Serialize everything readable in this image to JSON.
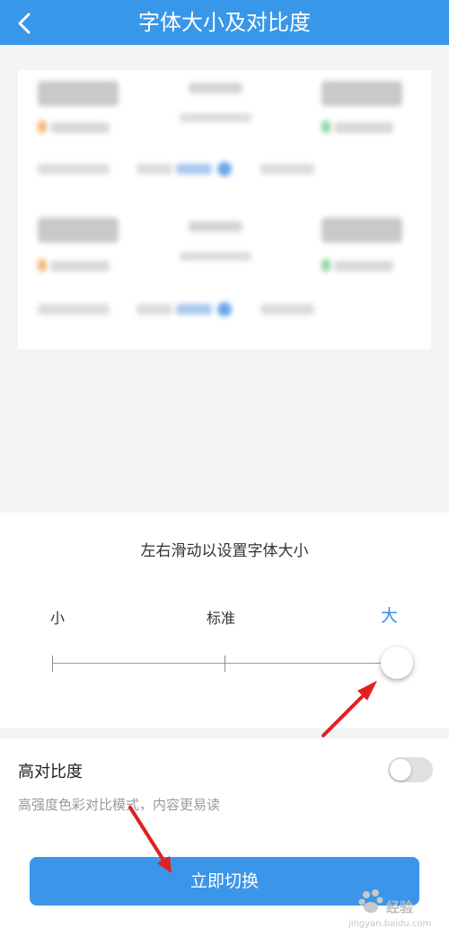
{
  "header": {
    "title": "字体大小及对比度",
    "back_icon": "chevron-left-icon"
  },
  "font_size": {
    "hint": "左右滑动以设置字体大小",
    "labels": {
      "small": "小",
      "standard": "标准",
      "large": "大"
    },
    "selected": "大",
    "level": 1.0
  },
  "contrast": {
    "title": "高对比度",
    "description": "高强度色彩对比模式，内容更易读",
    "enabled": false
  },
  "actions": {
    "switch_label": "立即切换"
  },
  "watermark": {
    "text": "经验",
    "sub": "jingyan.baidu.com"
  },
  "colors": {
    "accent": "#3897e8",
    "button": "#3b96ea",
    "arrow": "#e02020"
  }
}
